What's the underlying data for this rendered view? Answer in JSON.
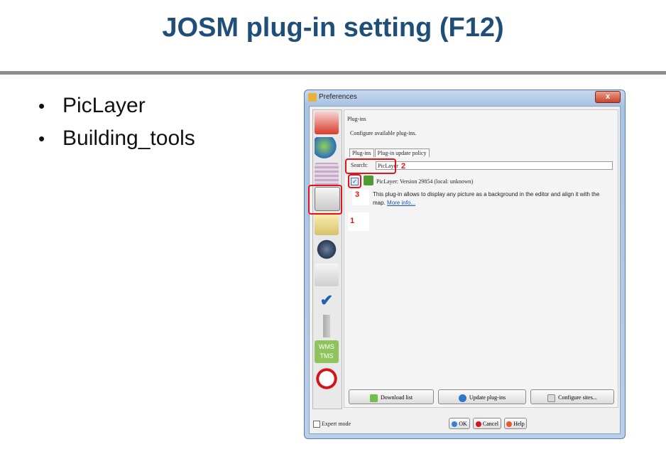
{
  "slide": {
    "title": "JOSM plug-in setting (F12)",
    "bullets": [
      "PicLayer",
      "Building_tools"
    ],
    "bullet_char": "•"
  },
  "window": {
    "title": "Preferences",
    "close_glyph": "x",
    "sidebar_icons": [
      "tag-icon",
      "globe-icon",
      "grid-icon",
      "plugin-icon",
      "projection-icon",
      "sound-icon",
      "keyboard-icon",
      "validator-icon",
      "remote-icon",
      "wms-tms-icon",
      "shortcut-icon"
    ],
    "wms_label": "WMS",
    "tms_label": "TMS"
  },
  "content": {
    "section_title": "Plug-ins",
    "section_desc": "Configure available plug-ins.",
    "tabs": [
      "Plug-ins",
      "Plug-in update policy"
    ],
    "search_label": "Search:",
    "search_value": "PicLayer",
    "plugin_name": "PicLayer: Version 29854 (local: unknown)",
    "plugin_checked": "✓",
    "plugin_desc": "This plug-in allows to display any picture as a background in the editor and align it with the map.",
    "more_info": "More info...",
    "annotations": [
      "1",
      "2",
      "3"
    ]
  },
  "buttons": {
    "download": "Download list",
    "update": "Update plug-ins",
    "configure": "Configure sites..."
  },
  "footer": {
    "expert_mode": "Expert mode",
    "ok": "OK",
    "cancel": "Cancel",
    "help": "Help"
  }
}
